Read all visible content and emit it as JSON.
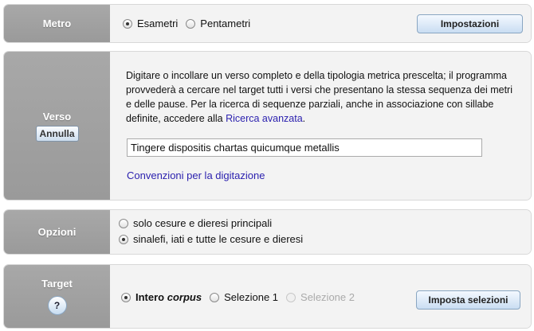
{
  "metro": {
    "label": "Metro",
    "options": [
      {
        "label": "Esametri",
        "checked": true
      },
      {
        "label": "Pentametri",
        "checked": false
      }
    ],
    "settings_button": "Impostazioni"
  },
  "verso": {
    "label": "Verso",
    "cancel_button": "Annulla",
    "description_part1": "Digitare o incollare un verso completo e della tipologia metrica prescelta; il programma provvederà a cercare nel target tutti i versi che presentano la stessa sequenza dei metri e delle pause. Per la ricerca di sequenze parziali, anche in associazione con sillabe definite, accedere alla ",
    "advanced_link": "Ricerca avanzata",
    "description_end": ".",
    "input_value": "Tingere dispositis chartas quicumque metallis",
    "conventions_link": "Convenzioni per la digitazione"
  },
  "opzioni": {
    "label": "Opzioni",
    "options": [
      {
        "label": "solo cesure e dieresi principali",
        "checked": false
      },
      {
        "label": "sinalefi, iati e tutte le cesure e dieresi",
        "checked": true
      }
    ]
  },
  "target": {
    "label": "Target",
    "help_button": "?",
    "option1_prefix": "Intero ",
    "option1_em": "corpus",
    "option2": "Selezione 1",
    "option3": "Selezione 2",
    "set_button": "Imposta selezioni"
  },
  "colors": {
    "label_bg": "#a0a0a0",
    "content_bg": "#f3f3f3",
    "link": "#2a1fae",
    "button_top": "#f4f9ff",
    "button_bottom": "#c9ddf2"
  }
}
